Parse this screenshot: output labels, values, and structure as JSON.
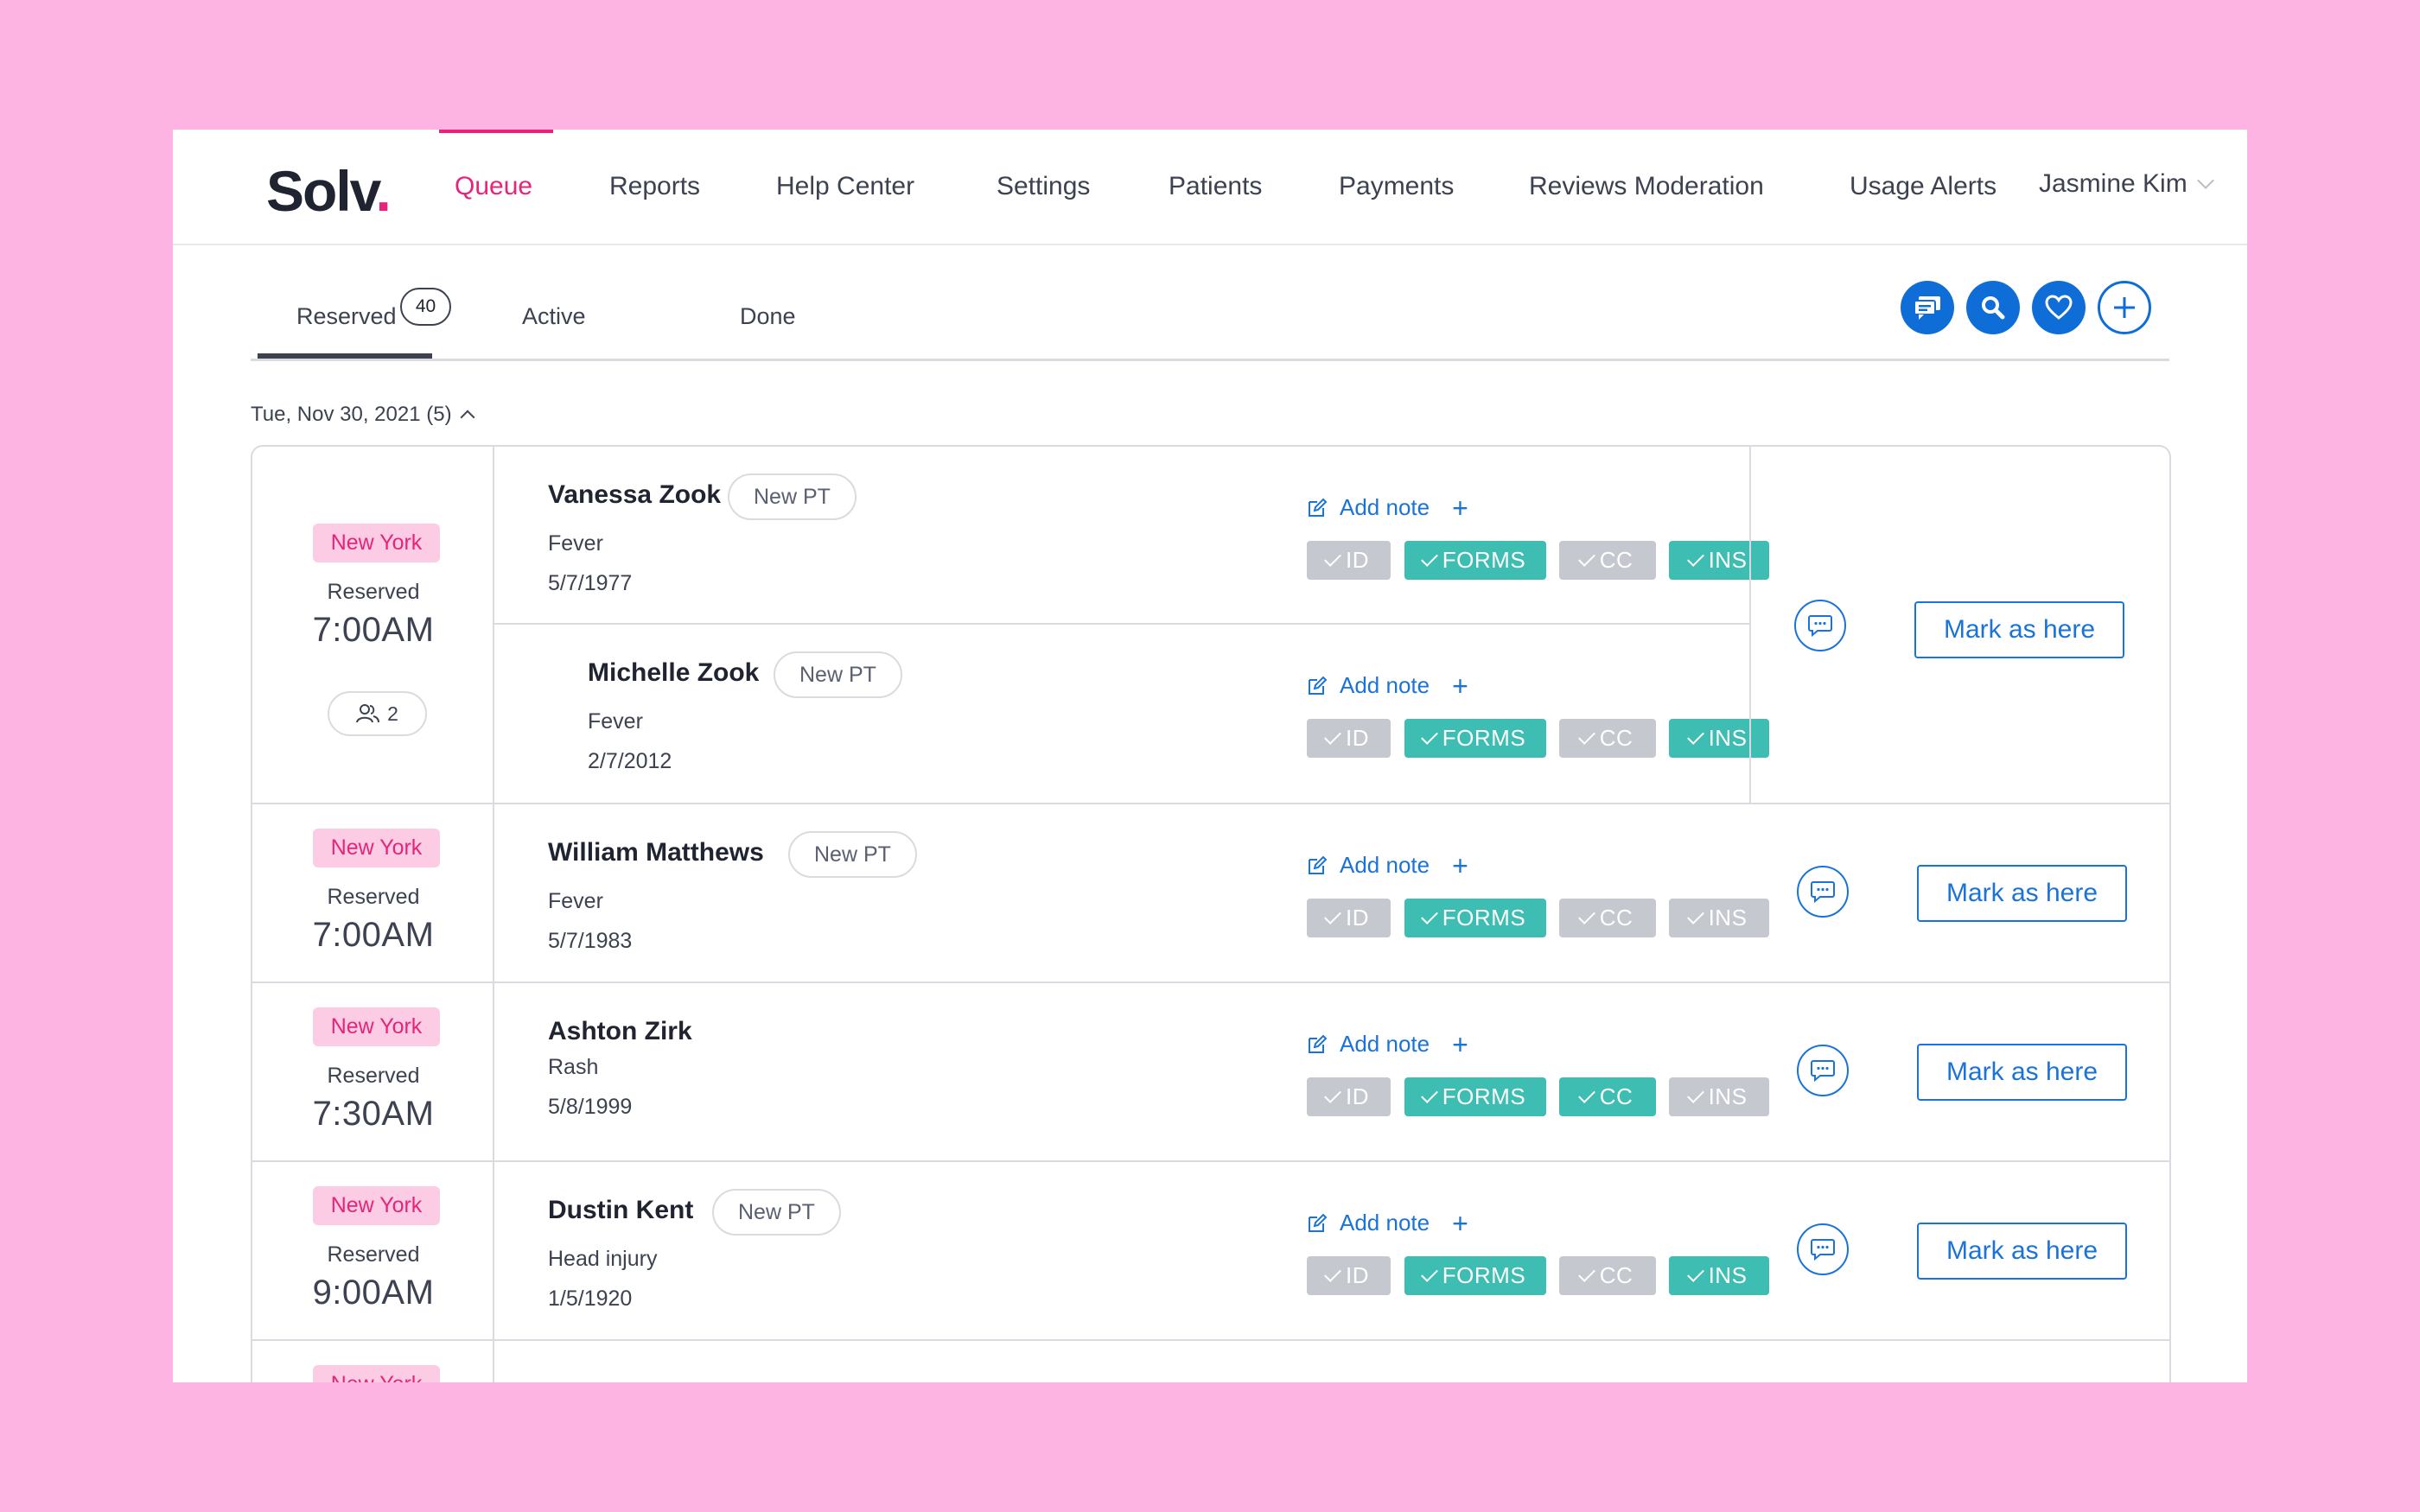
{
  "app": {
    "logo_text": "Solv",
    "logo_dot": "."
  },
  "nav": {
    "items": [
      {
        "label": "Queue",
        "active": true
      },
      {
        "label": "Reports"
      },
      {
        "label": "Help Center"
      },
      {
        "label": "Settings"
      },
      {
        "label": "Patients"
      },
      {
        "label": "Payments"
      },
      {
        "label": "Reviews Moderation"
      },
      {
        "label": "Usage Alerts"
      }
    ],
    "user": "Jasmine Kim"
  },
  "tabs": {
    "items": [
      {
        "label": "Reserved",
        "count": "40",
        "active": true
      },
      {
        "label": "Active"
      },
      {
        "label": "Done"
      }
    ]
  },
  "date_header": "Tue, Nov 30, 2021 (5)",
  "labels": {
    "add_note": "Add note",
    "mark_here": "Mark as here",
    "reserved": "Reserved",
    "new_pt": "New PT",
    "location": "New York"
  },
  "chip_labels": [
    "ID",
    "FORMS",
    "CC",
    "INS"
  ],
  "rows": [
    {
      "location": "New York",
      "status": "Reserved",
      "time": "7:00AM",
      "group_count": "2",
      "patients": [
        {
          "name": "Vanessa Zook",
          "new_pt": true,
          "reason": "Fever",
          "dob": "5/7/1977",
          "chips": [
            false,
            true,
            false,
            true
          ]
        },
        {
          "name": "Michelle Zook",
          "new_pt": true,
          "reason": "Fever",
          "dob": "2/7/2012",
          "chips": [
            false,
            true,
            false,
            true
          ]
        }
      ]
    },
    {
      "location": "New York",
      "status": "Reserved",
      "time": "7:00AM",
      "patients": [
        {
          "name": "William Matthews",
          "new_pt": true,
          "reason": "Fever",
          "dob": "5/7/1983",
          "chips": [
            false,
            true,
            false,
            false
          ]
        }
      ]
    },
    {
      "location": "New York",
      "status": "Reserved",
      "time": "7:30AM",
      "patients": [
        {
          "name": "Ashton Zirk",
          "new_pt": false,
          "reason": "Rash",
          "dob": "5/8/1999",
          "chips": [
            false,
            true,
            true,
            false
          ]
        }
      ]
    },
    {
      "location": "New York",
      "status": "Reserved",
      "time": "9:00AM",
      "patients": [
        {
          "name": "Dustin Kent",
          "new_pt": true,
          "reason": "Head injury",
          "dob": "1/5/1920",
          "chips": [
            false,
            true,
            false,
            true
          ]
        }
      ]
    }
  ],
  "colors": {
    "accent": "#e7247a",
    "primary": "#0f6dd8",
    "link": "#1a73d8",
    "chip_on": "#3ebdb2",
    "chip_off": "#c5c8cf",
    "background": "#feb4e3"
  },
  "icons": {
    "messages": "message-icon",
    "search": "search-icon",
    "favorite": "heart-icon",
    "add": "plus-icon",
    "chat": "chat-bubble-icon",
    "edit": "edit-icon",
    "group": "group-icon"
  }
}
